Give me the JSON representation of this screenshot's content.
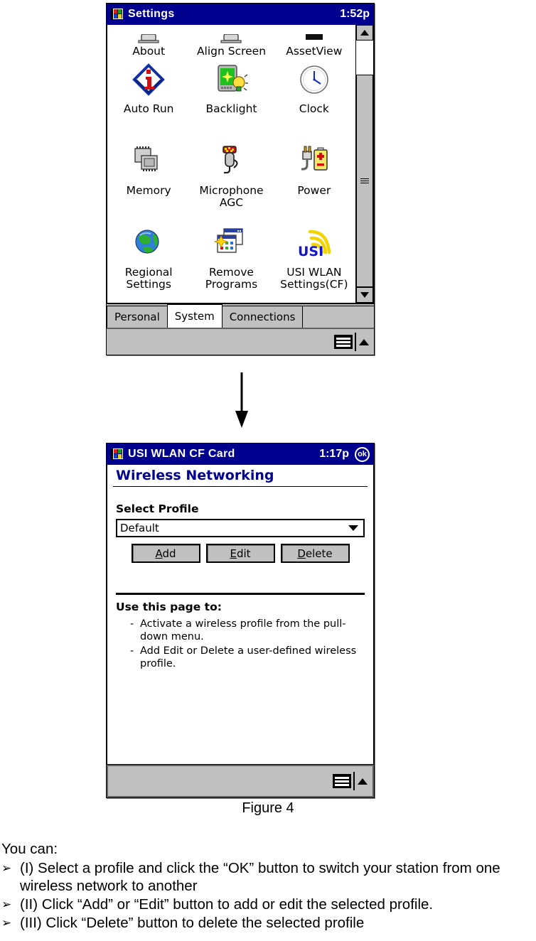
{
  "figure1": {
    "name": "settings-window",
    "titlebar": {
      "icon": "start-flag-icon",
      "title": "Settings",
      "time": "1:52p"
    },
    "icons": [
      {
        "label": "About",
        "icon": "about-icon"
      },
      {
        "label": "Align Screen",
        "icon": "align-screen-icon"
      },
      {
        "label": "AssetView",
        "icon": "assetview-icon"
      },
      {
        "label": "Auto Run",
        "icon": "auto-run-icon"
      },
      {
        "label": "Backlight",
        "icon": "backlight-icon"
      },
      {
        "label": "Clock",
        "icon": "clock-icon"
      },
      {
        "label": "Memory",
        "icon": "memory-icon"
      },
      {
        "label": "Microphone AGC",
        "icon": "microphone-agc-icon"
      },
      {
        "label": "Power",
        "icon": "power-icon"
      },
      {
        "label": "Regional Settings",
        "icon": "regional-settings-icon"
      },
      {
        "label": "Remove Programs",
        "icon": "remove-programs-icon"
      },
      {
        "label": "USI WLAN Settings(CF)",
        "icon": "usi-wlan-icon"
      }
    ],
    "tabs": [
      {
        "label": "Personal",
        "active": false
      },
      {
        "label": "System",
        "active": true
      },
      {
        "label": "Connections",
        "active": false
      }
    ],
    "taskbar": {
      "keyboard_icon": "keyboard-icon",
      "expand_icon": "triangle-up-icon"
    },
    "scrollbar": {
      "up_icon": "triangle-up-icon",
      "down_icon": "triangle-down-icon"
    }
  },
  "arrow": {
    "name": "flow-arrow-down",
    "icon": "arrow-down-icon"
  },
  "figure2": {
    "name": "usi-wlan-window",
    "titlebar": {
      "icon": "start-flag-icon",
      "title": "USI WLAN CF Card",
      "time": "1:17p",
      "ok_label": "ok"
    },
    "page_header": "Wireless Networking",
    "select_profile_label": "Select Profile",
    "profile_value": "Default",
    "profile_options": [
      "Default"
    ],
    "buttons": [
      {
        "name": "add-button",
        "pre": "",
        "mnemonic": "A",
        "post": "dd"
      },
      {
        "name": "edit-button",
        "pre": "",
        "mnemonic": "E",
        "post": "dit"
      },
      {
        "name": "delete-button",
        "pre": "",
        "mnemonic": "D",
        "post": "elete"
      }
    ],
    "use_header": "Use this page to:",
    "use_items": [
      "Activate a wireless profile from the pull-down menu.",
      "Add Edit or Delete a user-defined wireless profile."
    ],
    "bullet_dash": "-",
    "taskbar": {
      "keyboard_icon": "keyboard-icon",
      "expand_icon": "triangle-up-icon"
    }
  },
  "caption": "Figure 4",
  "prose": {
    "lead": "You can:",
    "bullet_glyph": "➢",
    "items": [
      "(I) Select a profile and click the “OK” button to switch your station from one wireless network to another",
      "(II) Click “Add” or “Edit” button to add or edit the selected profile.",
      "(III) Click “Delete” button to delete the selected profile"
    ]
  },
  "colors": {
    "titlebar_blue": "#00008f",
    "header_blue": "#00008f",
    "chrome_gray": "#c0c0c0"
  }
}
